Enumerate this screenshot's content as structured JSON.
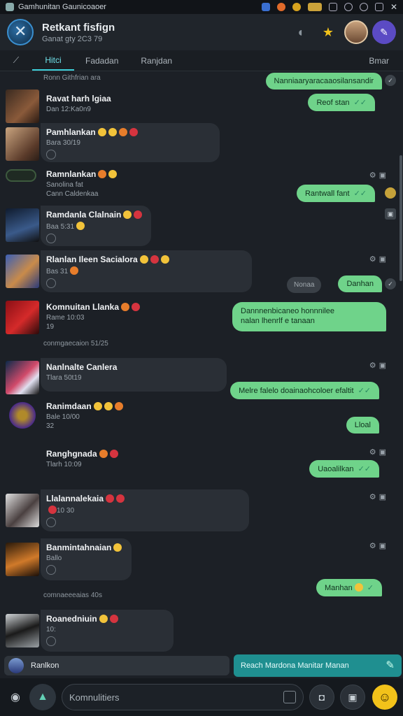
{
  "statusbar": {
    "title": "Gamhunitan Gaunicoaoer"
  },
  "header": {
    "name": "Retkant fisfign",
    "sub": "Ganat gty 2C3 79",
    "star": "★"
  },
  "tabs": [
    {
      "label": "Hitci"
    },
    {
      "label": "Fadadan"
    },
    {
      "label": "Ranjdan"
    },
    {
      "label": "Bmar"
    }
  ],
  "messages": {
    "top_sys": "Ronn Githfrian ara",
    "b0": "Nanniaaryaracaaosilansandir",
    "b1": "Reof stan",
    "r1": {
      "name": "Ravat harh lgiaa",
      "meta": "Dan 12:Ka0n9"
    },
    "r2": {
      "name": "Pamhlankan",
      "meta": "Bara 30/19"
    },
    "r3": {
      "name": "Ramnlankan",
      "meta": "Sanolina fat",
      "sub": "Cann Caldenkaa"
    },
    "b2": "Rantwall fant",
    "r4": {
      "name": "Ramdanla Clalnain",
      "meta": "Baa 5:31"
    },
    "r5": {
      "name": "Rlanlan Ileen Sacialora",
      "meta": "Bas 31"
    },
    "gray1": "Nonaa",
    "b3": "Danhan",
    "r6": {
      "name": "Komnuitan Llanka",
      "meta": "Rame 10:03",
      "sub": "19"
    },
    "b4a": "Dannnenbicaneo honnnilee",
    "b4b": "nalan lhenrlf e tanaan",
    "sys2": "conmgaecaion 51/25",
    "r7": {
      "name": "Nanlnalte Canlera",
      "meta": "Tlara 50t19"
    },
    "b5": "Melre falelo doainaohcoloer efaltit",
    "r8": {
      "name": "Ranimdaan",
      "meta": "Bale 10/00",
      "sub": "32"
    },
    "b6": "Lloal",
    "r9": {
      "name": "Ranghgnada",
      "meta": "Tlarh 10:09"
    },
    "b7": "Uaoalilkan",
    "r10": {
      "name": "Llalannalekaia",
      "meta": "10 30"
    },
    "r11": {
      "name": "Banmintahnaian",
      "meta": "Ballo"
    },
    "b8": "Manhan",
    "sys3": "comnaeeeaias 40s",
    "r12": {
      "name": "Roanedniuin",
      "meta": "10:"
    }
  },
  "bottom": {
    "left_label": "Ranlkon",
    "right_label": "Reach Mardona Manitar Manan",
    "placeholder": "Komnulitiers"
  }
}
